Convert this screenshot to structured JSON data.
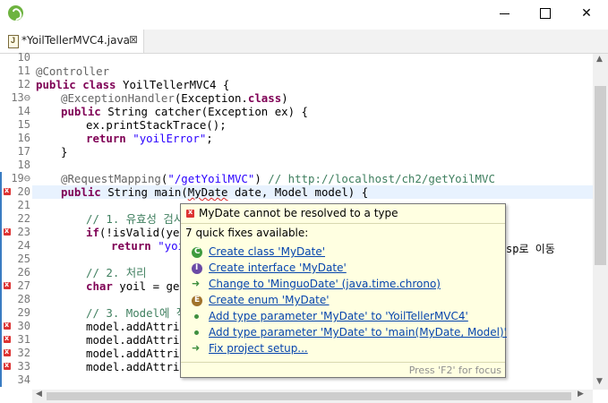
{
  "window": {
    "close_glyph": "✕"
  },
  "tab": {
    "label": "*YoilTellerMVC4.java",
    "close_glyph": "⊠"
  },
  "editor": {
    "line_numbers": [
      "10",
      "11",
      "12",
      "13⊖",
      "14",
      "15",
      "16",
      "17",
      "18",
      "19⊖",
      "20",
      "21",
      "22",
      "23",
      "24",
      "25",
      "26",
      "27",
      "28",
      "29",
      "30",
      "31",
      "32",
      "33",
      "34"
    ],
    "code": {
      "l11": "@Controller",
      "l12_kw": "public class",
      "l12_rest": " YoilTellerMVC4 {",
      "l13_ann": "@ExceptionHandler",
      "l13_rest": "(Exception.",
      "l13_kw": "class",
      "l13_end": ")",
      "l14_kw": "public",
      "l14_rest": " String catcher(Exception ex) {",
      "l15": "ex.printStackTrace();",
      "l16_kw": "return",
      "l16_str": "\"yoilError\"",
      "l16_end": ";",
      "l17": "}",
      "l19_ann": "@RequestMapping",
      "l19_open": "(",
      "l19_str": "\"/getYoilMVC\"",
      "l19_close": ") ",
      "l19_cmt": "// http://localhost/ch2/getYoilMVC",
      "l20_kw": "public",
      "l20_a": " String main(",
      "l20_err": "MyDate",
      "l20_b": " date, Model model) {",
      "l22_cmt": "// 1. 유효성 검사",
      "l23_kw": "if",
      "l23_rest": "(!isValid(yea",
      "l24_kw": "return",
      "l24_str": " \"yoi",
      "l26_cmt": "// 2. 처리",
      "l27_kw": "char",
      "l27_rest": " yoil = get",
      "l29_cmt": "// 3. Model에 작",
      "l30": "model.addAttrib",
      "l31": "model.addAttrib",
      "l32": "model.addAttrib",
      "l33": "model.addAttrib",
      "behind_popup": "sp로 이동"
    }
  },
  "quickfix": {
    "title": "MyDate cannot be resolved to a type",
    "count_text": "7 quick fixes available:",
    "fixes": [
      {
        "label": "Create class 'MyDate'",
        "icon": "class-icon"
      },
      {
        "label": "Create interface 'MyDate'",
        "icon": "interface-icon"
      },
      {
        "label": "Change to 'MinguoDate' (java.time.chrono)",
        "icon": "change-arrow-icon"
      },
      {
        "label": "Create enum 'MyDate'",
        "icon": "enum-icon"
      },
      {
        "label": "Add type parameter 'MyDate' to 'YoilTellerMVC4'",
        "icon": "type-param-icon"
      },
      {
        "label": "Add type parameter 'MyDate' to 'main(MyDate, Model)'",
        "icon": "type-param-icon"
      },
      {
        "label": "Fix project setup...",
        "icon": "change-arrow-icon"
      }
    ],
    "footer_hint": "Press 'F2' for focus"
  },
  "colors": {
    "keyword": "#7f0055",
    "string": "#2a00ff",
    "comment": "#3f7f5f",
    "annotation": "#646464",
    "current_line": "#e8f2fe",
    "popup_bg": "#ffffe1"
  }
}
